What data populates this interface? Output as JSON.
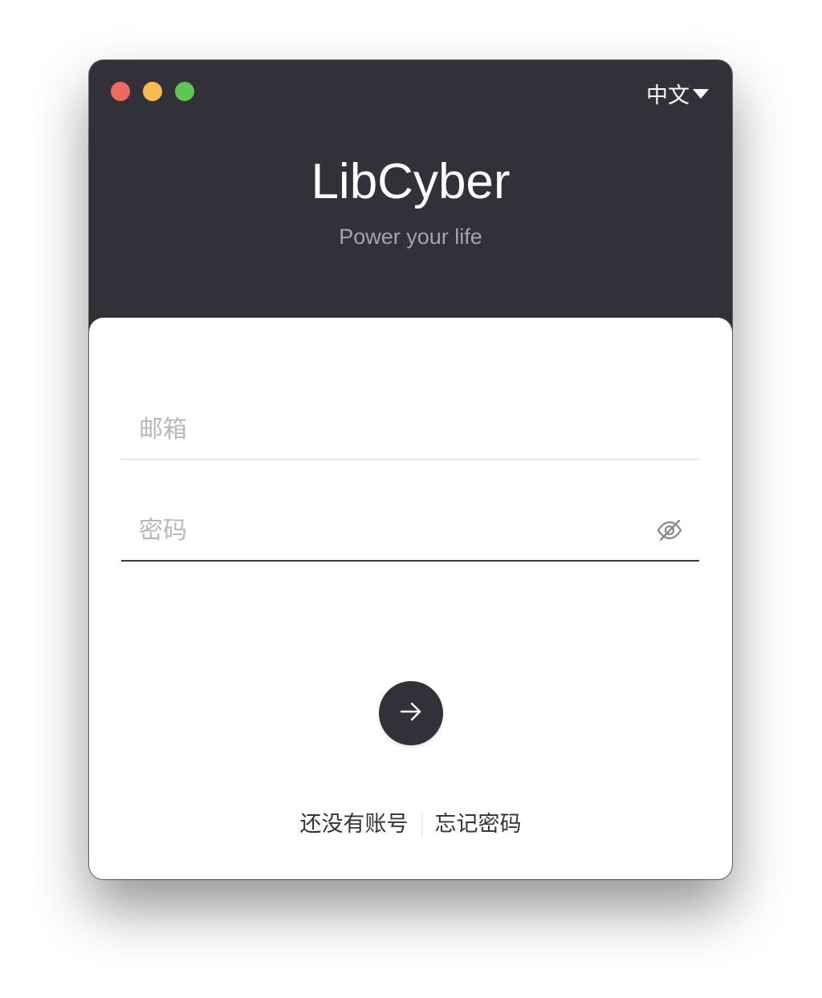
{
  "window": {
    "controls": [
      {
        "name": "close",
        "color": "#ee6a5f"
      },
      {
        "name": "minimize",
        "color": "#f5bd4f"
      },
      {
        "name": "zoom",
        "color": "#61c554"
      }
    ],
    "language": {
      "label": "中文",
      "icon": "caret-down-icon"
    }
  },
  "header": {
    "title": "LibCyber",
    "tagline": "Power your life"
  },
  "form": {
    "email": {
      "placeholder": "邮箱",
      "value": ""
    },
    "password": {
      "placeholder": "密码",
      "value": "",
      "toggle_icon": "eye-off-icon"
    },
    "submit_icon": "arrow-right-icon"
  },
  "footer": {
    "register_label": "还没有账号",
    "forgot_label": "忘记密码"
  },
  "colors": {
    "header_bg": "#32313a",
    "accent": "#32313a",
    "card_bg": "#ffffff"
  }
}
